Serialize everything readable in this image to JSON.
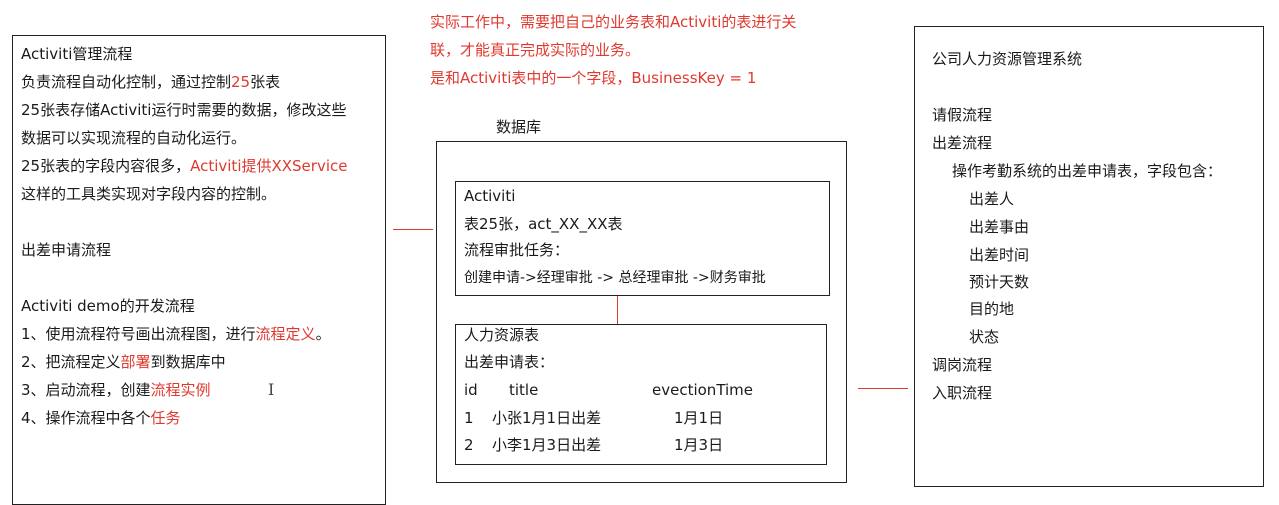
{
  "top_note": {
    "line1": "实际工作中，需要把自己的业务表和Activiti的表进行关",
    "line2": "联，才能真正完成实际的业务。",
    "line3": "是和Activiti表中的一个字段，BusinessKey   = 1"
  },
  "left": {
    "title": "Activiti管理流程",
    "l2_a": "负责流程自动化控制，通过控制",
    "l2_b": "25",
    "l2_c": "张表",
    "l3": "25张表存储Activiti运行时需要的数据，修改这些",
    "l4": "数据可以实现流程的自动化运行。",
    "l5_a": "25张表的字段内容很多，",
    "l5_b": "Activiti提供XXService",
    "l6": "这样的工具类实现对字段内容的控制。",
    "l7": "出差申请流程",
    "l8": "Activiti demo的开发流程",
    "s1_a": "1、使用流程符号画出流程图，进行",
    "s1_b": "流程定义",
    "s1_c": "。",
    "s2_a": "2、把流程定义",
    "s2_b": "部署",
    "s2_c": "到数据库中",
    "s3_a": "3、启动流程，创建",
    "s3_b": "流程实例",
    "s4_a": "4、操作流程中各个",
    "s4_b": "任务",
    "cursor": "I"
  },
  "db": {
    "label": "数据库",
    "activiti": {
      "title": "Activiti",
      "l2": "表25张，act_XX_XX表",
      "l3": "流程审批任务：",
      "l4": "创建申请->经理审批 -> 总经理审批 ->财务审批"
    },
    "hr": {
      "title": "人力资源表",
      "subtitle": "出差申请表：",
      "columns": [
        "id",
        "title",
        "evectionTime"
      ],
      "rows": [
        [
          "1",
          "小张1月1日出差",
          "1月1日"
        ],
        [
          "2",
          "小李1月3日出差",
          "1月3日"
        ]
      ]
    }
  },
  "right": {
    "title": "公司人力资源管理系统",
    "p1": "请假流程",
    "p2": "出差流程",
    "p2_desc": "操作考勤系统的出差申请表，字段包含：",
    "fields": [
      "出差人",
      "出差事由",
      "出差时间",
      "预计天数",
      "目的地",
      "状态"
    ],
    "p3": "调岗流程",
    "p4": "入职流程"
  },
  "colors": {
    "accent": "#e0392f",
    "border": "#222222"
  }
}
